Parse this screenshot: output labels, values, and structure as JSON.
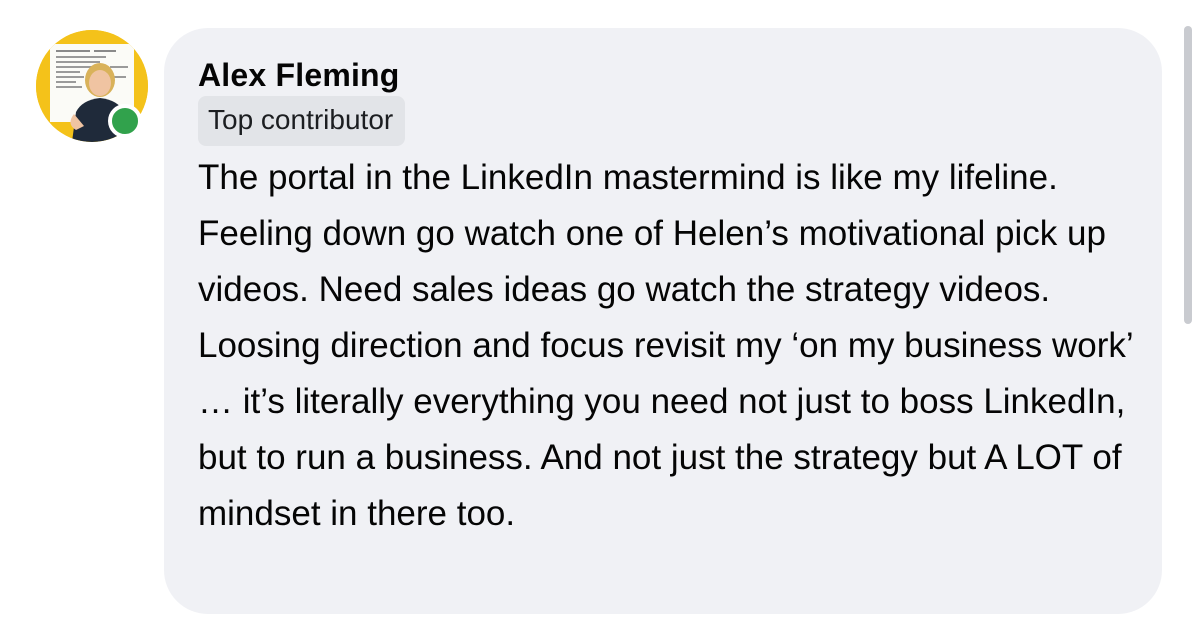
{
  "comment": {
    "author_name": "Alex Fleming",
    "badge_label": "Top contributor",
    "body_text": "The portal in the LinkedIn mastermind is like my lifeline. Feeling down go watch one of Helen’s motivational pick up videos. Need sales ideas go watch the strategy videos. Loosing direction and focus revisit my ‘on my business work’ … it’s literally everything you need not just to boss LinkedIn, but to run a business. And not just the strategy but A LOT of mindset in there too."
  },
  "avatar": {
    "icon": "profile-photo-icon",
    "online_status_icon": "online-dot-icon",
    "ring_color": "#f4c21a",
    "online_color": "#31a24c"
  },
  "colors": {
    "bubble_bg": "#f0f1f5",
    "badge_bg": "#e2e4e8",
    "text": "#050505"
  }
}
